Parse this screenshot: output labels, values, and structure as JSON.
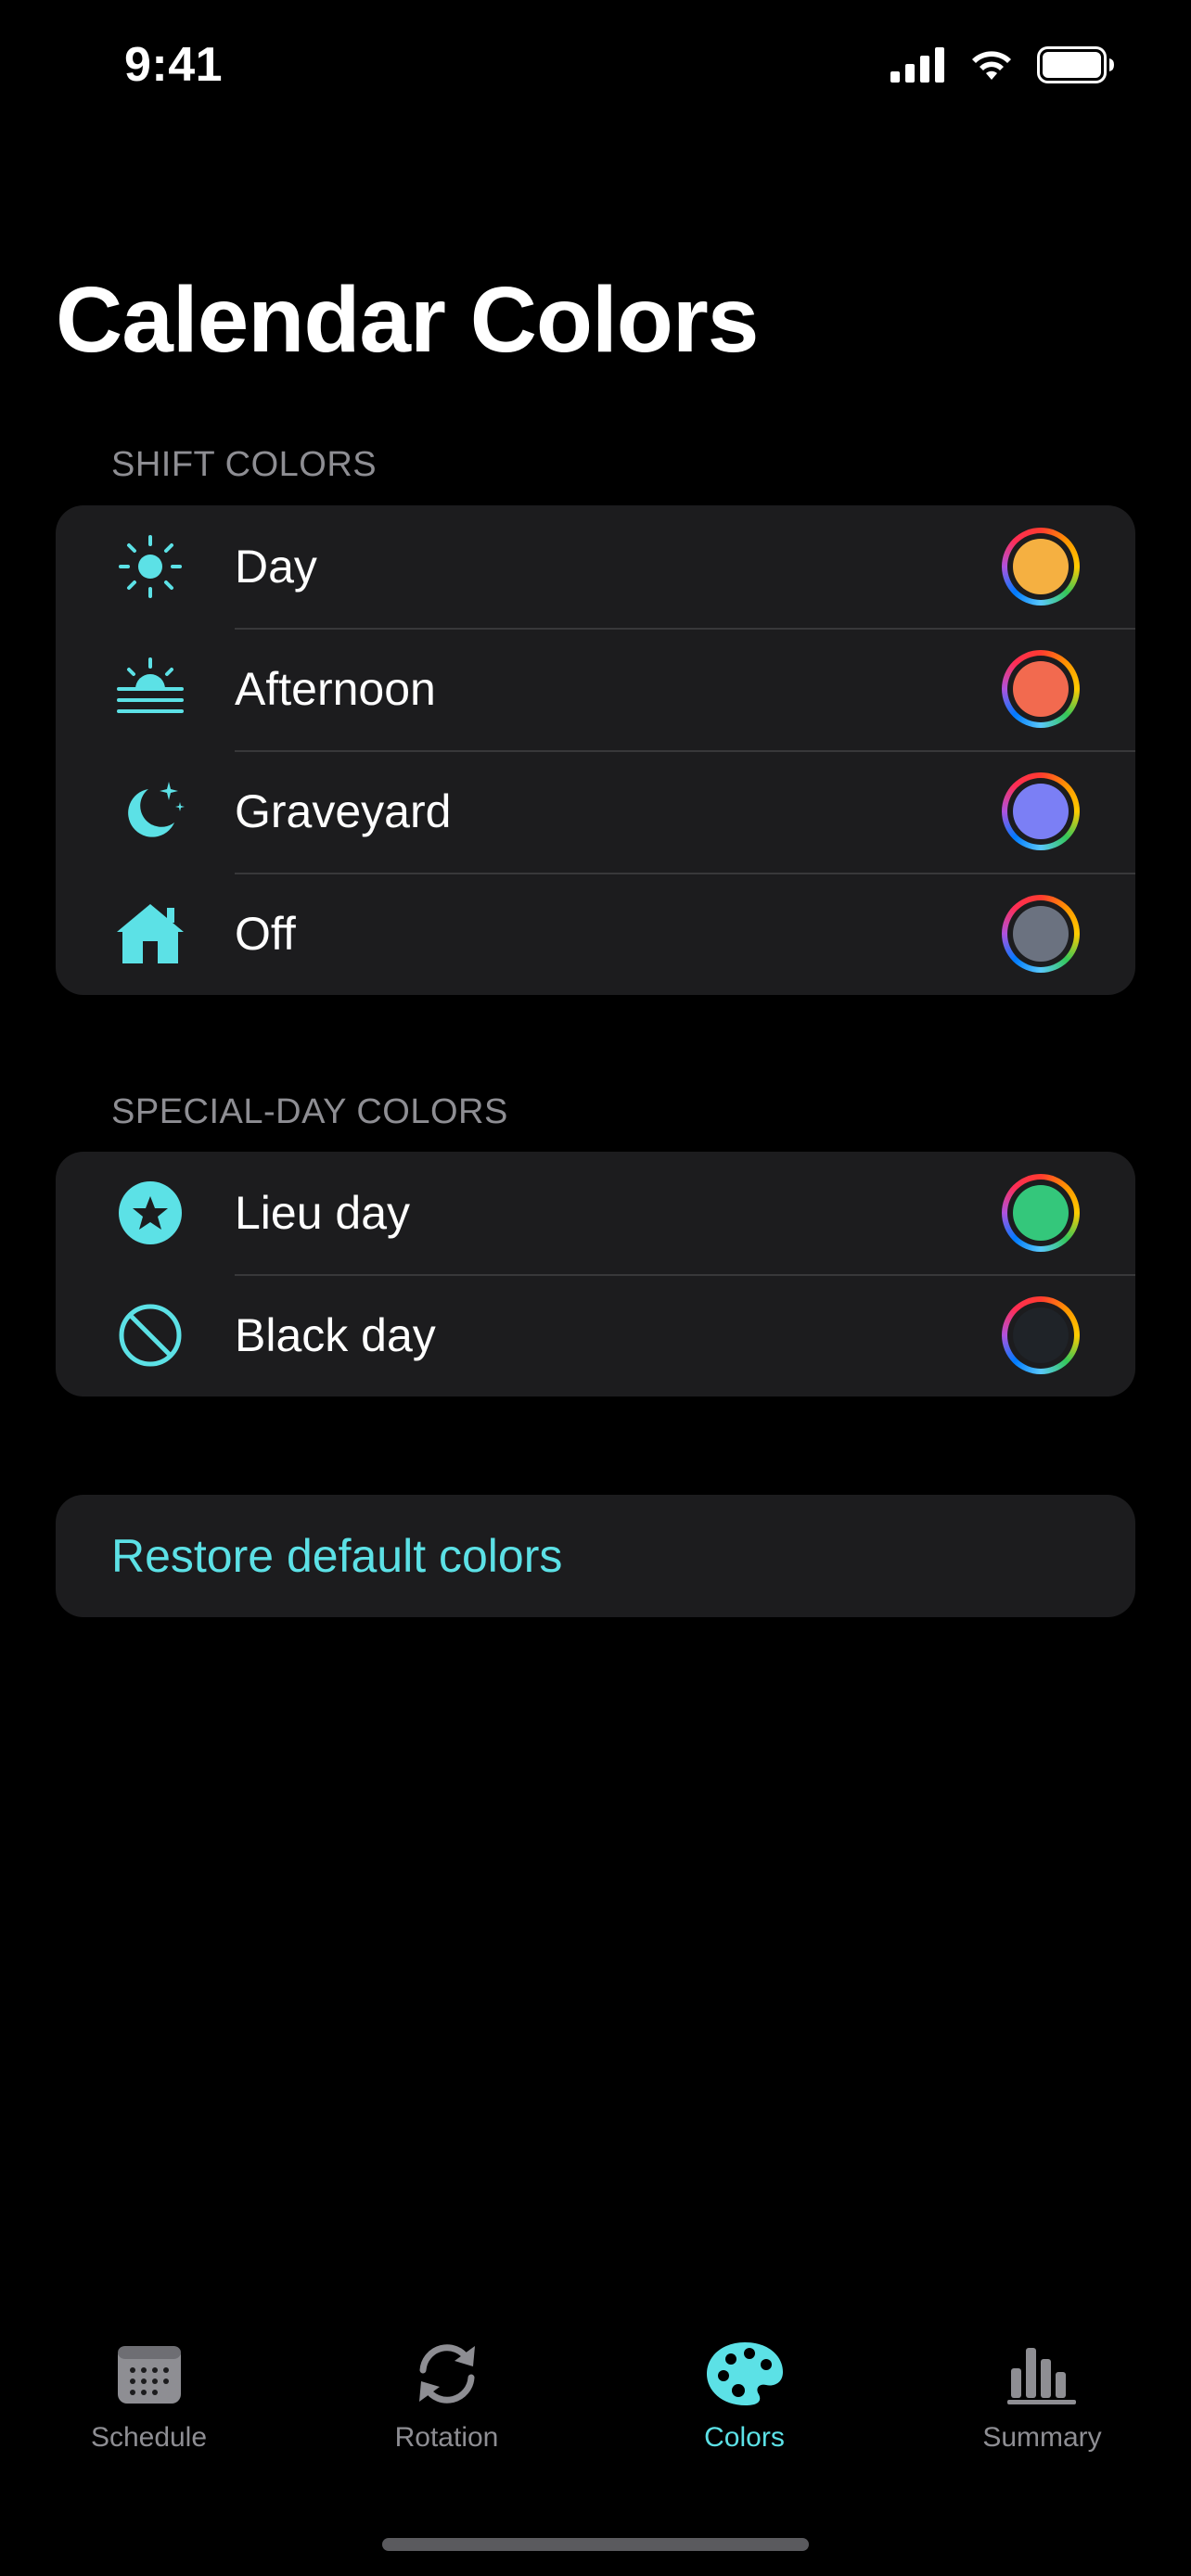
{
  "status_bar": {
    "time": "9:41"
  },
  "page": {
    "title": "Calendar Colors"
  },
  "shift_colors": {
    "header": "SHIFT COLORS",
    "items": [
      {
        "label": "Day",
        "icon": "sun-icon",
        "color": "#f5b041"
      },
      {
        "label": "Afternoon",
        "icon": "sunset-icon",
        "color": "#f26a4f"
      },
      {
        "label": "Graveyard",
        "icon": "moon-stars-icon",
        "color": "#7b7ff5"
      },
      {
        "label": "Off",
        "icon": "house-icon",
        "color": "#6b7280"
      }
    ]
  },
  "special_day_colors": {
    "header": "SPECIAL-DAY COLORS",
    "items": [
      {
        "label": "Lieu day",
        "icon": "star-circle-icon",
        "color": "#34c77b"
      },
      {
        "label": "Black day",
        "icon": "prohibited-icon",
        "color": "#1f2328"
      }
    ]
  },
  "restore_button": {
    "label": "Restore default colors"
  },
  "tab_bar": {
    "tabs": [
      {
        "label": "Schedule",
        "icon": "calendar-icon",
        "active": false
      },
      {
        "label": "Rotation",
        "icon": "arrows-cycle-icon",
        "active": false
      },
      {
        "label": "Colors",
        "icon": "palette-icon",
        "active": true
      },
      {
        "label": "Summary",
        "icon": "bar-chart-icon",
        "active": false
      }
    ]
  },
  "theme": {
    "accent": "#5ce1e6",
    "background": "#000000",
    "group_background": "#1c1c1e",
    "secondary_text": "#8e8e93"
  }
}
